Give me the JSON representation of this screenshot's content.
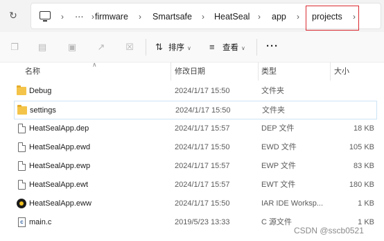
{
  "address_bar": {
    "breadcrumbs": [
      "···",
      "firmware",
      "Smartsafe",
      "HeatSeal",
      "app",
      "projects"
    ],
    "refresh_icon": "refresh-icon",
    "computer_icon": "computer-icon"
  },
  "toolbar": {
    "icons": [
      "copy-icon",
      "paste-icon",
      "rename-icon",
      "share-icon",
      "delete-icon"
    ],
    "sort_label": "排序",
    "view_label": "查看",
    "more_label": "···"
  },
  "columns": {
    "name": "名称",
    "date": "修改日期",
    "type": "类型",
    "size": "大小"
  },
  "files": [
    {
      "name": "Debug",
      "date": "2024/1/17 15:50",
      "type": "文件夹",
      "size": "",
      "icon": "folder"
    },
    {
      "name": "settings",
      "date": "2024/1/17 15:50",
      "type": "文件夹",
      "size": "",
      "icon": "folder"
    },
    {
      "name": "HeatSealApp.dep",
      "date": "2024/1/17 15:57",
      "type": "DEP 文件",
      "size": "18 KB",
      "icon": "file"
    },
    {
      "name": "HeatSealApp.ewd",
      "date": "2024/1/17 15:50",
      "type": "EWD 文件",
      "size": "105 KB",
      "icon": "file"
    },
    {
      "name": "HeatSealApp.ewp",
      "date": "2024/1/17 15:57",
      "type": "EWP 文件",
      "size": "83 KB",
      "icon": "file"
    },
    {
      "name": "HeatSealApp.ewt",
      "date": "2024/1/17 15:57",
      "type": "EWT 文件",
      "size": "180 KB",
      "icon": "file"
    },
    {
      "name": "HeatSealApp.eww",
      "date": "2024/1/17 15:50",
      "type": "IAR IDE Worksp...",
      "size": "1 KB",
      "icon": "iar"
    },
    {
      "name": "main.c",
      "date": "2019/5/23 13:33",
      "type": "C 源文件",
      "size": "1 KB",
      "icon": "c"
    }
  ],
  "selected_index": 1,
  "watermark": "CSDN @sscb0521",
  "colors": {
    "highlight": "#d9282f",
    "folder": "#f4c44a",
    "selection": "#cde4f7"
  }
}
